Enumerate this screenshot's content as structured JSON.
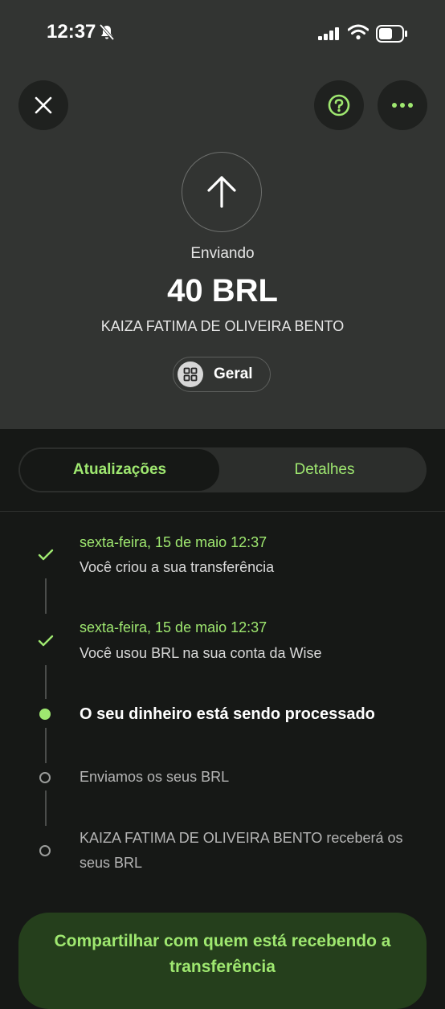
{
  "status_bar": {
    "time": "12:37"
  },
  "header": {
    "status": "Enviando",
    "amount": "40 BRL",
    "recipient": "KAIZA FATIMA DE OLIVEIRA BENTO",
    "category": "Geral"
  },
  "tabs": [
    {
      "label": "Atualizações",
      "active": true
    },
    {
      "label": "Detalhes",
      "active": false
    }
  ],
  "timeline": [
    {
      "date": "sexta-feira, 15 de maio 12:37",
      "text": "Você criou a sua transferência",
      "state": "done"
    },
    {
      "date": "sexta-feira, 15 de maio 12:37",
      "text": "Você usou BRL na sua conta da Wise",
      "state": "done"
    },
    {
      "text": "O seu dinheiro está sendo processado",
      "state": "current"
    },
    {
      "text": "Enviamos os seus BRL",
      "state": "pending"
    },
    {
      "text": "KAIZA FATIMA DE OLIVEIRA BENTO receberá os seus BRL",
      "state": "pending"
    }
  ],
  "share_button": {
    "label": "Compartilhar com quem está recebendo a transferência"
  },
  "icons": {
    "close": "close-icon",
    "help": "help-icon",
    "more": "more-icon",
    "send": "arrow-up-icon",
    "category": "grid-icon",
    "silent": "bell-slash-icon"
  },
  "colors": {
    "accent": "#9fe870",
    "header_bg": "#323432",
    "page_bg": "#161816",
    "button_bg": "#253f1c"
  }
}
